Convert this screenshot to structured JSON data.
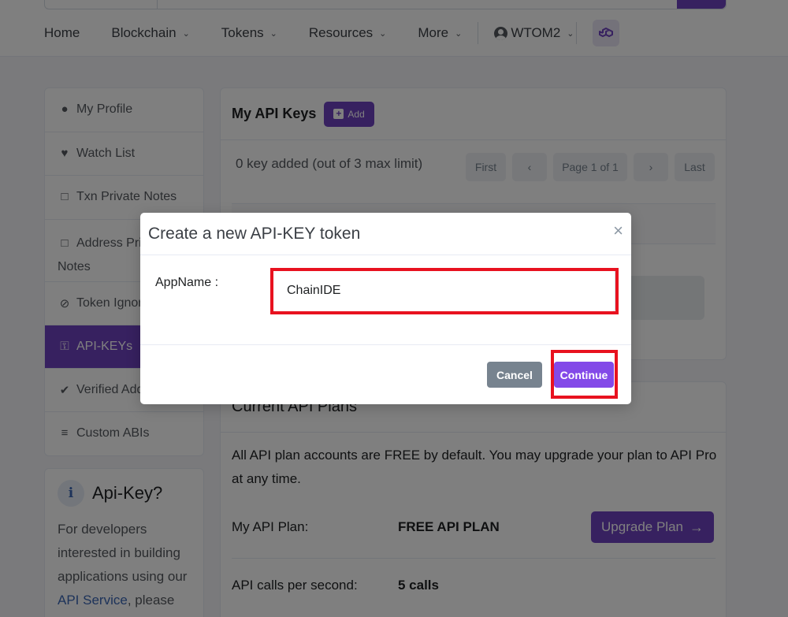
{
  "nav": {
    "items": [
      {
        "label": "Home"
      },
      {
        "label": "Blockchain"
      },
      {
        "label": "Tokens"
      },
      {
        "label": "Resources"
      },
      {
        "label": "More"
      }
    ],
    "user": "WTOM2"
  },
  "sidebar": {
    "items": [
      {
        "label": "My Profile",
        "icon": "user-circle-icon"
      },
      {
        "label": "Watch List",
        "icon": "heart-icon"
      },
      {
        "label": "Txn Private Notes",
        "icon": "note-icon"
      },
      {
        "label": "Address Private",
        "label2": "Notes",
        "icon": "note-icon"
      },
      {
        "label": "Token Ignore List",
        "icon": "eye-slash-icon"
      },
      {
        "label": "API-KEYs",
        "icon": "key-icon"
      },
      {
        "label": "Verified Address",
        "icon": "badge-check-icon"
      },
      {
        "label": "Custom ABIs",
        "icon": "list-check-icon"
      }
    ],
    "active_color": "#6f42c1"
  },
  "info_card": {
    "title": "Api-Key?",
    "text": "For developers interested in building applications using our",
    "link": "API Service",
    "text_after": ", please"
  },
  "keys_card": {
    "title": "My API Keys",
    "add_label": "Add",
    "status": "0 key added (out of 3 max limit)",
    "pager": {
      "first": "First",
      "prev": "‹",
      "page": "Page 1 of 1",
      "next": "›",
      "last": "Last"
    }
  },
  "plans_card": {
    "title": "Current API Plans",
    "description": "All API plan accounts are FREE by default. You may upgrade your plan to API Pro at any time.",
    "plan_label": "My API Plan:",
    "plan_value": "FREE API PLAN",
    "upgrade_label": "Upgrade Plan",
    "calls_label": "API calls per second:",
    "calls_value": "5 calls"
  },
  "modal": {
    "title": "Create a new API-KEY token",
    "close": "×",
    "field_label": "AppName :",
    "field_value": "ChainIDE",
    "cancel_label": "Cancel",
    "continue_label": "Continue",
    "highlight_color": "#e8121f"
  }
}
